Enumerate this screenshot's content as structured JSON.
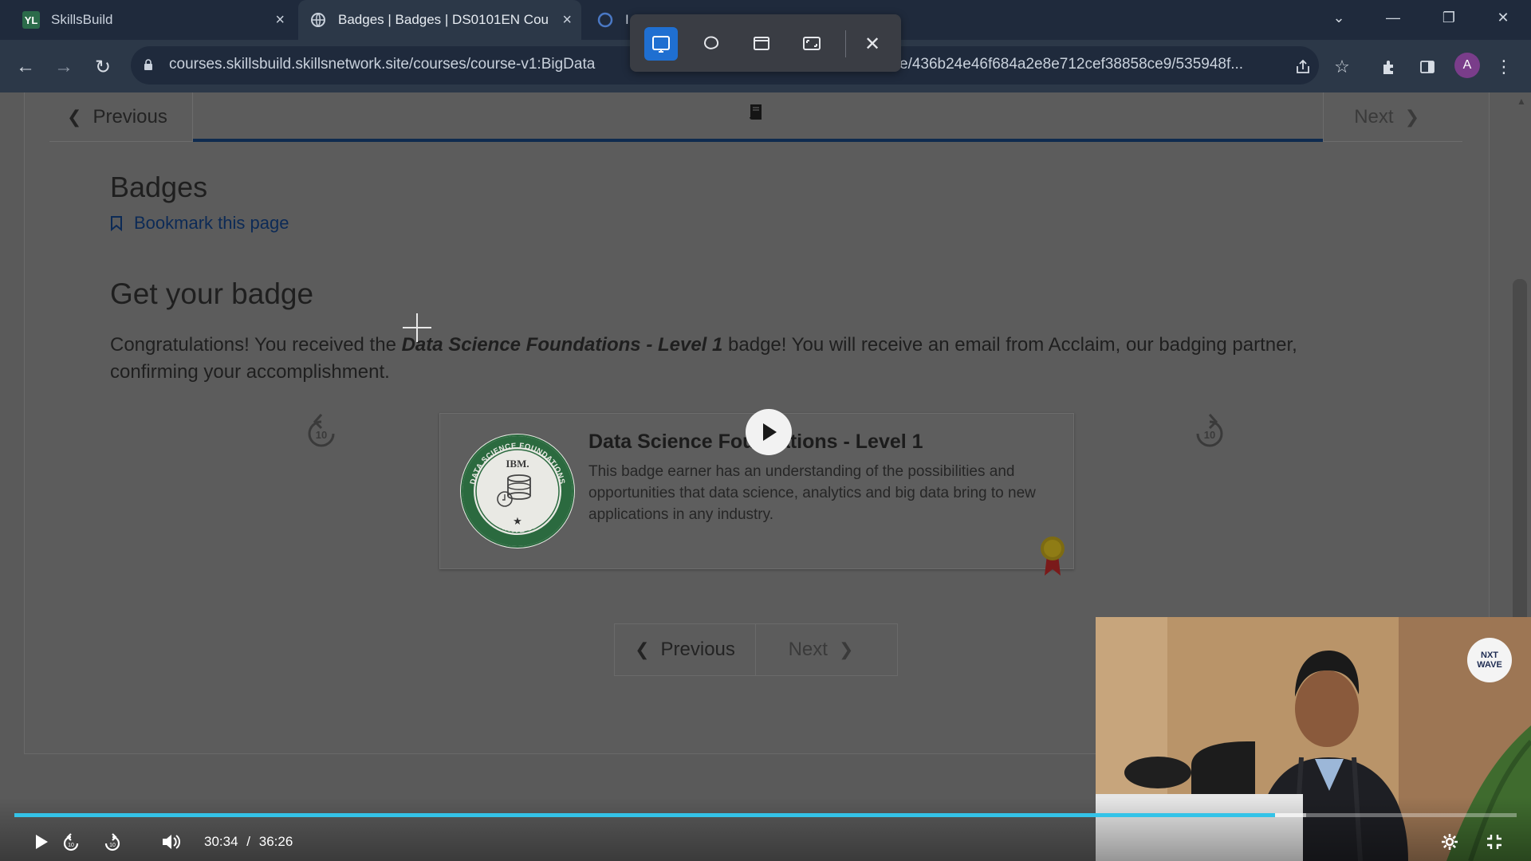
{
  "browser": {
    "tabs": [
      {
        "title": "SkillsBuild",
        "favicon": "skillsbuild-logo"
      },
      {
        "title": "Badges | Badges | DS0101EN Cou",
        "favicon": "globe-icon"
      },
      {
        "title": "I",
        "favicon": "loading-circle-icon"
      }
    ],
    "url_visible_left": "courses.skillsbuild.skillsnetwork.site/courses/course-v1:BigData",
    "url_visible_right": "e/436b24e46f684a2e8e712cef38858ce9/535948f...",
    "profile_initial": "A"
  },
  "snip_toolbar": {
    "modes": [
      "rectangle-snip",
      "freeform-snip",
      "window-snip",
      "fullscreen-snip"
    ],
    "active_mode": "rectangle-snip"
  },
  "course": {
    "seq_prev": "Previous",
    "seq_next": "Next",
    "unit_title": "Badges",
    "bookmark": "Bookmark this page",
    "heading": "Get your badge",
    "para_before": "Congratulations! You received the ",
    "para_badge": "Data Science Foundations - Level 1",
    "para_after": " badge! You will receive an email from Acclaim, our badging partner, confirming your accomplishment.",
    "badge": {
      "title": "Data Science Foundations - Level 1",
      "description": "This badge earner has an understanding of the possibilities and opportunities that data science, analytics and big data bring to new applications in any industry.",
      "ring_text_top": "DATA SCIENCE FOUNDATIONS",
      "ring_text_bottom": "COGNITIVE CLASS",
      "center_text": "IBM."
    },
    "bottom_prev": "Previous",
    "bottom_next": "Next"
  },
  "video": {
    "skip_seconds": "10",
    "current_time": "30:34",
    "separator": "/",
    "duration": "36:26",
    "progress": 0.839,
    "buffered": 0.86,
    "overlay_logo": "NXT WAVE"
  },
  "colors": {
    "progress": "#34c3e8",
    "snip_active": "#1f6fd1",
    "link": "#0c2a56"
  }
}
